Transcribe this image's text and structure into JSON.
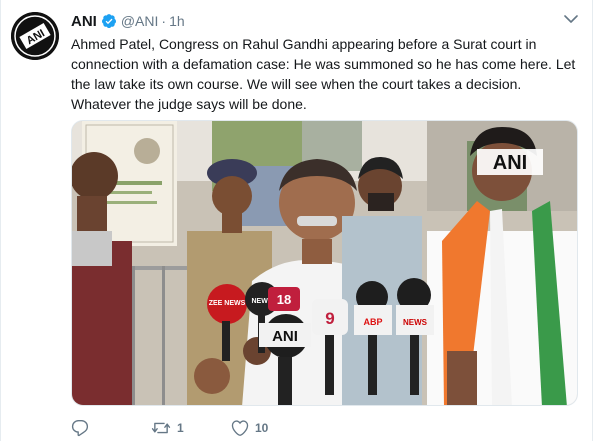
{
  "tweet": {
    "author": {
      "display_name": "ANI",
      "handle": "@ANI",
      "verified": true,
      "avatar_icon": "ani-logo-icon"
    },
    "separator": "·",
    "time": "1h",
    "text": "Ahmed Patel, Congress on Rahul Gandhi appearing before a Surat court in connection with a defamation case: He was summoned so he has come here. Let the law take its own course. We will see when the court takes a decision. Whatever the judge says will be done.",
    "media": {
      "watermark": "ANI",
      "mic_labels": [
        "ZEE NEWS",
        "NEWS",
        "18",
        "ANI",
        "9",
        "ABP",
        "NEWS"
      ]
    },
    "actions": {
      "reply_icon": "reply-icon",
      "retweet_icon": "retweet-icon",
      "retweet_count": "1",
      "like_icon": "heart-icon",
      "like_count": "10"
    },
    "menu_icon": "chevron-down-icon"
  },
  "colors": {
    "text_primary": "#14171a",
    "text_secondary": "#657786",
    "verified_blue": "#1da1f2",
    "border": "#e6ecf0"
  }
}
